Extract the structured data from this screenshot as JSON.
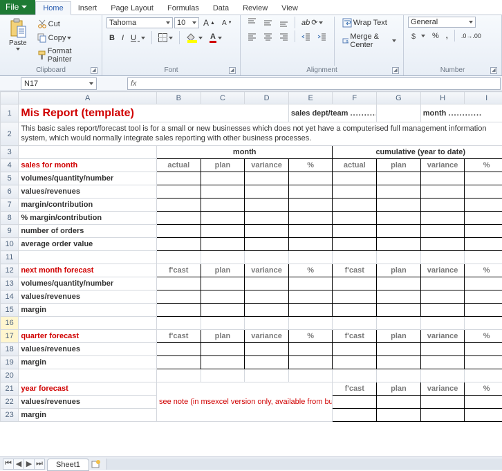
{
  "tabs": {
    "file": "File",
    "home": "Home",
    "insert": "Insert",
    "pageLayout": "Page Layout",
    "formulas": "Formulas",
    "data": "Data",
    "review": "Review",
    "view": "View"
  },
  "ribbon": {
    "clipboard": {
      "paste": "Paste",
      "cut": "Cut",
      "copy": "Copy",
      "fmt": "Format Painter",
      "label": "Clipboard"
    },
    "font": {
      "face": "Tahoma",
      "size": "10",
      "bold": "B",
      "italic": "I",
      "underline": "U",
      "label": "Font"
    },
    "alignment": {
      "wrap": "Wrap Text",
      "merge": "Merge & Center",
      "label": "Alignment"
    },
    "number": {
      "format": "General",
      "label": "Number"
    }
  },
  "namebox": "N17",
  "fx_label": "fx",
  "formula": "",
  "cols": [
    "A",
    "B",
    "C",
    "D",
    "E",
    "F",
    "G",
    "H",
    "I"
  ],
  "rows": [
    "1",
    "2",
    "3",
    "4",
    "5",
    "6",
    "7",
    "8",
    "9",
    "10",
    "11",
    "12",
    "13",
    "14",
    "15",
    "16",
    "17",
    "18",
    "19",
    "20",
    "21",
    "22",
    "23"
  ],
  "sheet": {
    "title": "Mis Report (template)",
    "dept_label": "sales dept/team",
    "dept_dots": "............",
    "month_label": "month",
    "month_dots": "............",
    "desc": "This basic sales report/forecast tool is for a small or new businesses which does not yet have a computerised full management information system, which would normally integrate sales reporting with other business processes.",
    "super": {
      "month": "month",
      "cum": "cumulative (year to date)"
    },
    "cols": {
      "actual": "actual",
      "plan": "plan",
      "variance": "variance",
      "pct": "%",
      "fcast": "f'cast"
    },
    "sections": {
      "sales": "sales for month",
      "salesRows": [
        "volumes/quantity/number",
        "values/revenues",
        "margin/contribution",
        "% margin/contribution",
        "number of orders",
        "average order value"
      ],
      "nextMonth": "next month forecast",
      "nextRows": [
        "volumes/quantity/number",
        "values/revenues",
        "margin"
      ],
      "quarter": "quarter forecast",
      "quarterRows": [
        "values/revenues",
        "margin"
      ],
      "year": "year forecast",
      "yearRows": [
        "values/revenues",
        "margin"
      ]
    },
    "note": "see note (in msexcel version only, available from businessballs.com)"
  },
  "sheetTab": "Sheet1"
}
